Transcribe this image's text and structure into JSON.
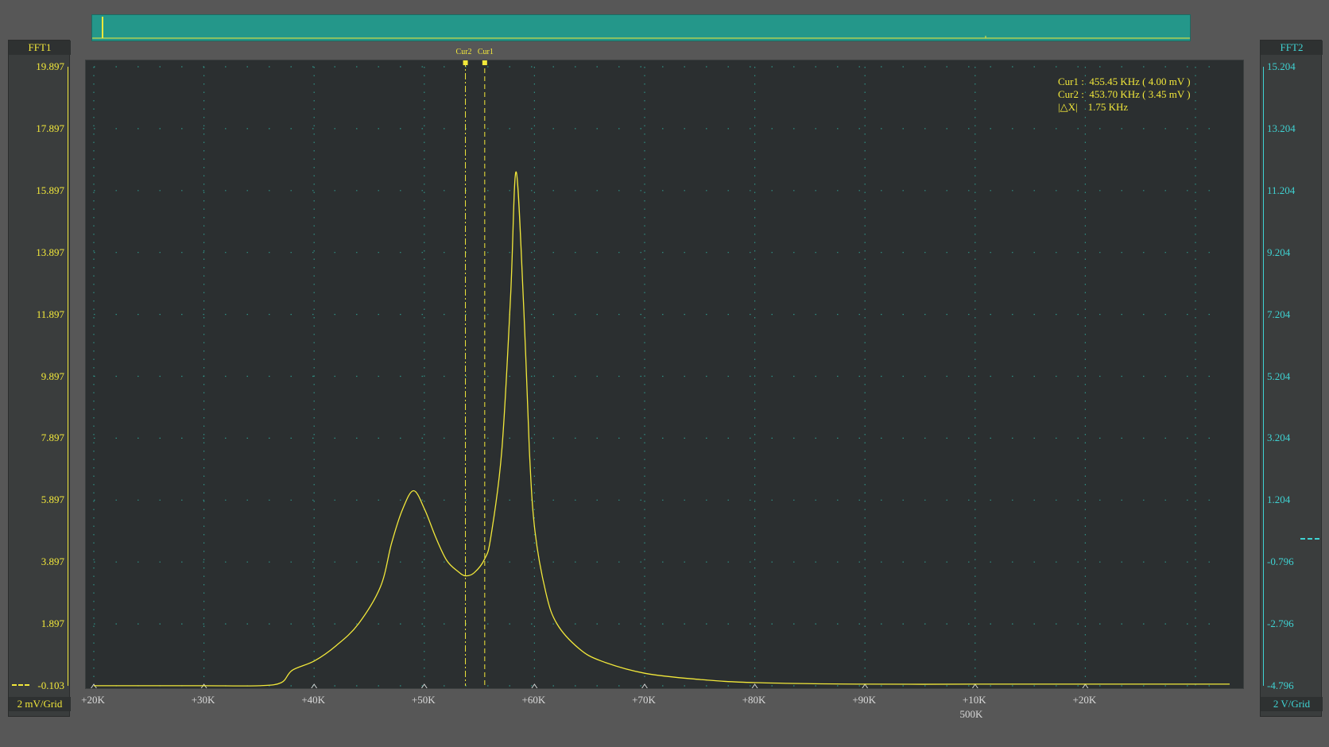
{
  "colors": {
    "fft1": "#f2e83a",
    "fft2": "#3fd2d2",
    "overview": "#24978a",
    "plot_bg": "#2b2f30",
    "grid_dot": "#2fa89a"
  },
  "left_panel": {
    "title": "FFT1",
    "scale": "2 mV/Grid",
    "ticks": [
      "19.897",
      "17.897",
      "15.897",
      "13.897",
      "11.897",
      "9.897",
      "7.897",
      "5.897",
      "3.897",
      "1.897",
      "-0.103"
    ]
  },
  "right_panel": {
    "title": "FFT2",
    "scale": "2 V/Grid",
    "ticks": [
      "15.204",
      "13.204",
      "11.204",
      "9.204",
      "7.204",
      "5.204",
      "3.204",
      "1.204",
      "-0.796",
      "-2.796",
      "-4.796"
    ]
  },
  "cursors": {
    "cur1_label": "Cur1",
    "cur2_label": "Cur2",
    "readout": [
      "Cur1 :  455.45 KHz ( 4.00 mV )",
      "Cur2 :  453.70 KHz ( 3.45 mV )",
      "|△X|    1.75 KHz"
    ]
  },
  "x_axis": {
    "ticks": [
      "+20K",
      "+30K",
      "+40K",
      "+50K",
      "+60K",
      "+70K",
      "+80K",
      "+90K",
      "+10K",
      "+20K"
    ],
    "center_label": "500K"
  },
  "chart_data": {
    "type": "line",
    "title": "",
    "xlabel": "500K",
    "ylabel": "",
    "x_unit": "kHz",
    "y_unit": "mV",
    "xlim": [
      420,
      523
    ],
    "ylim": [
      -0.103,
      19.897
    ],
    "grid": true,
    "series": [
      {
        "name": "FFT1",
        "x": [
          420,
          425,
          430,
          435,
          437,
          438,
          440,
          442,
          444,
          446,
          447,
          448,
          449,
          450,
          451,
          452,
          453,
          453.7,
          454.5,
          455.45,
          456,
          457,
          457.8,
          458.3,
          459,
          459.5,
          460,
          461,
          462,
          464,
          466,
          470,
          475,
          480,
          490,
          500,
          510,
          520,
          523
        ],
        "y": [
          -0.1,
          -0.1,
          -0.1,
          -0.1,
          0.0,
          0.4,
          0.7,
          1.2,
          1.9,
          3.1,
          4.5,
          5.6,
          6.2,
          5.6,
          4.7,
          3.95,
          3.6,
          3.45,
          3.55,
          4.0,
          4.7,
          7.5,
          12.5,
          16.5,
          12.0,
          7.5,
          4.9,
          2.9,
          1.9,
          1.1,
          0.7,
          0.3,
          0.1,
          0.0,
          -0.05,
          -0.05,
          -0.05,
          -0.05,
          -0.05
        ]
      }
    ],
    "cursors_khz": {
      "cur1": 455.45,
      "cur2": 453.7
    }
  }
}
